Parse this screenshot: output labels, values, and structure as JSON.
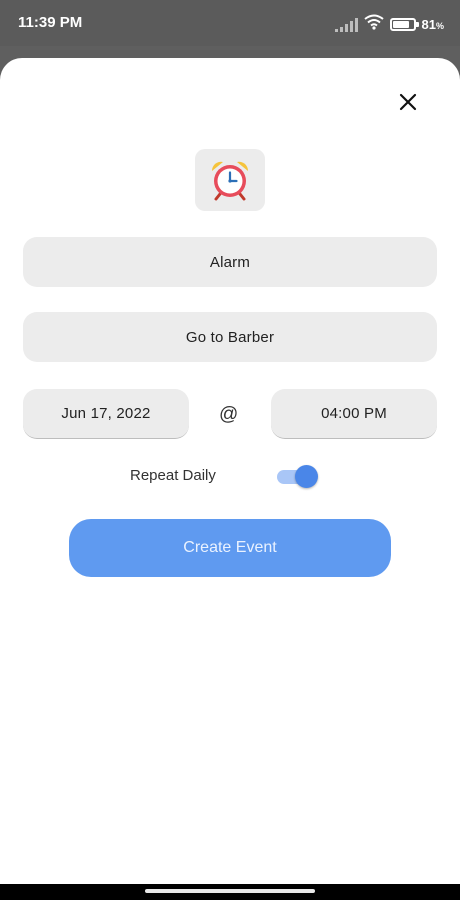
{
  "status_bar": {
    "time": "11:39 PM",
    "battery_percent": "81",
    "battery_unit": "%",
    "battery_level": 0.81,
    "icons": [
      "signal-icon",
      "wifi-icon",
      "battery-icon"
    ]
  },
  "sheet": {
    "close_icon": "close-icon",
    "event_icon": "alarm-clock-icon",
    "type_field": {
      "value": "Alarm"
    },
    "title_field": {
      "value": "Go to Barber"
    },
    "date_field": {
      "value": "Jun 17, 2022"
    },
    "at_separator": "@",
    "time_field": {
      "value": "04:00 PM"
    },
    "repeat_label": "Repeat Daily",
    "repeat_enabled": true,
    "create_button_label": "Create Event"
  },
  "colors": {
    "accent": "#5f9af0",
    "toggle_on": "#4a86e8",
    "field_bg": "#ececec",
    "backdrop": "#5f5f5f"
  }
}
